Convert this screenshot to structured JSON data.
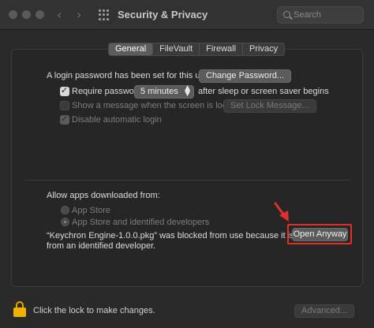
{
  "window": {
    "title": "Security & Privacy",
    "search_placeholder": "Search"
  },
  "tabs": [
    {
      "label": "General",
      "active": true
    },
    {
      "label": "FileVault",
      "active": false
    },
    {
      "label": "Firewall",
      "active": false
    },
    {
      "label": "Privacy",
      "active": false
    }
  ],
  "general": {
    "login_text": "A login password has been set for this user",
    "change_password_button": "Change Password...",
    "require_password_label": "Require password",
    "require_password_checked": true,
    "require_password_value": "5 minutes",
    "after_sleep_text": "after sleep or screen saver begins",
    "show_message_label": "Show a message when the screen is locked",
    "show_message_checked": false,
    "set_lock_message_button": "Set Lock Message...",
    "disable_auto_login_label": "Disable automatic login",
    "disable_auto_login_checked": true
  },
  "apps": {
    "heading": "Allow apps downloaded from:",
    "options": [
      {
        "label": "App Store",
        "selected": false
      },
      {
        "label": "App Store and identified developers",
        "selected": true
      }
    ],
    "blocked_line1": "“Keychron Engine-1.0.0.pkg” was blocked from use because it is not",
    "blocked_line2": "from an identified developer.",
    "open_anyway_button": "Open Anyway"
  },
  "footer": {
    "lock_text": "Click the lock to make changes.",
    "advanced_button": "Advanced..."
  },
  "colors": {
    "highlight": "#e1302a",
    "arrow": "#e1302a",
    "lock": "#f2b100"
  }
}
